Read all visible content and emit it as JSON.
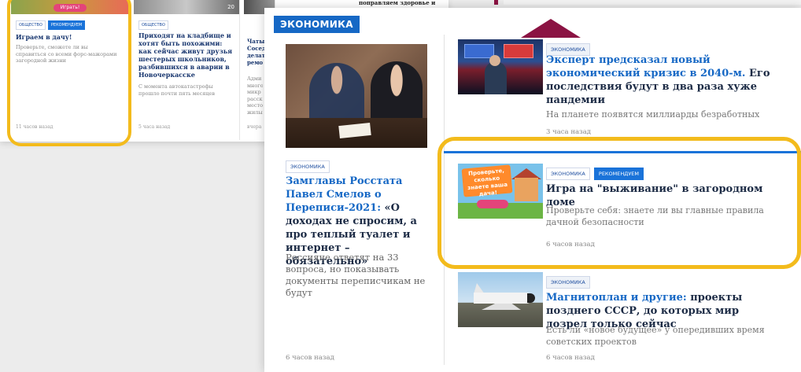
{
  "background": {
    "cards": [
      {
        "tags": [
          "общество",
          "рекомендуем"
        ],
        "cta": "Играть!",
        "title": "Играем в дачу!",
        "text": "Проверьте, сможете ли вы справиться со всеми форс-мажорами загородной жизни",
        "time": "11 часов назад"
      },
      {
        "tags": [
          "общество"
        ],
        "photo_counter": "20",
        "title": "Приходят на кладбище и хотят быть похожими: как сейчас живут друзья шестерых школьников, разбившихся в аварии в Новочеркасске",
        "text": "С момента автокатастрофы прошло почти пять месяцев",
        "time": "5 часа назад"
      },
      {
        "title_fragment": "Чаты Сосед делать ремо",
        "text_fragment": "Адми много микр расск место жилы",
        "time": "вчера"
      }
    ],
    "top_right_fragment": "поправляем здоровье и"
  },
  "panel": {
    "section_label": "ЭКОНОМИКА",
    "lead": {
      "tag": "экономика",
      "title_accent": "Замглавы Росстата Павел Смелов о Переписи-2021:",
      "title_rest": " «О доходах не спросим, а про теплый туалет и интернет – обязательно»",
      "description": "Россияне ответят на 33 вопроса, но показывать документы переписчикам не будут",
      "time": "6 часов назад"
    },
    "items": [
      {
        "tags": [
          "экономика"
        ],
        "title_accent": "Эксперт предсказал новый экономический кризис в 2040-м.",
        "title_rest": " Его последствия будут в два раза хуже пандемии",
        "description": "На планете появятся миллиарды безработных",
        "time": "3 часа назад"
      },
      {
        "tags": [
          "экономика",
          "рекомендуем"
        ],
        "thumb_banner": "Проверьте, сколько знаете ваша дача!",
        "title_accent": "",
        "title_rest": "Игра на \"выживание\" в загородном доме",
        "description": "Проверьте себя: знаете ли вы главные правила дачной безопасности",
        "time": "6 часов назад"
      },
      {
        "tags": [
          "экономика"
        ],
        "title_accent": "Магнитоплан и другие:",
        "title_rest": " проекты позднего СССР, до которых мир дозрел только сейчас",
        "description": "Есть ли «новое будущее» у опередивших время советских проектов",
        "time": "6 часов назад"
      }
    ]
  },
  "colors": {
    "brand_blue": "#1668c5",
    "recommend_blue": "#1a73d9",
    "highlight_yellow": "#f3bb1c",
    "arrow_maroon": "#8b1343"
  }
}
